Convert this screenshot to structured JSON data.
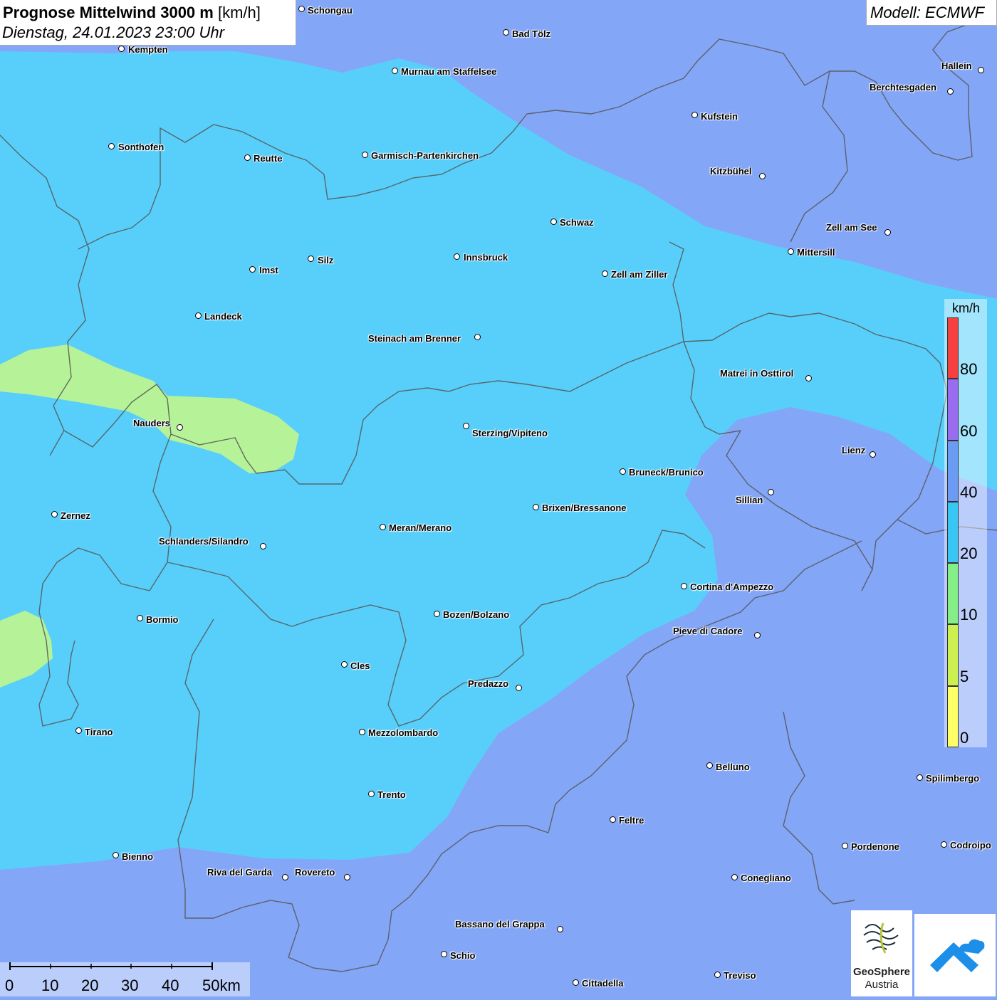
{
  "title": {
    "main_bold": "Prognose Mittelwind 3000 m",
    "main_unit": "[km/h]",
    "subtitle": "Dienstag, 24.01.2023 23:00 Uhr"
  },
  "model": "Modell: ECMWF",
  "legend": {
    "unit": "km/h",
    "classes": [
      {
        "label": "0",
        "color": "#ffff66"
      },
      {
        "label": "5",
        "color": "#ccf050"
      },
      {
        "label": "10",
        "color": "#84ef86"
      },
      {
        "label": "20",
        "color": "#38c6f4"
      },
      {
        "label": "40",
        "color": "#6b9bf2"
      },
      {
        "label": "60",
        "color": "#9a6cf0"
      },
      {
        "label": "80",
        "color": "#f64040"
      }
    ]
  },
  "field_colors": {
    "below_10": "#b6f297",
    "range_20_40": "#58cffa",
    "range_40_60": "#84a6f7"
  },
  "scale_bar": {
    "labels": [
      "0",
      "10",
      "20",
      "30",
      "40",
      "50km"
    ]
  },
  "cities": [
    "Schongau",
    "Bad Tölz",
    "Kempten",
    "Murnau am Staffelsee",
    "Hallein",
    "Berchtesgaden",
    "Kufstein",
    "Sonthofen",
    "Reutte",
    "Garmisch-Partenkirchen",
    "Kitzbühel",
    "Schwaz",
    "Zell am See",
    "Mittersill",
    "Innsbruck",
    "Silz",
    "Imst",
    "Zell am Ziller",
    "Landeck",
    "Steinach am Brenner",
    "Matrei in Osttirol",
    "Nauders",
    "Sterzing/Vipiteno",
    "Lienz",
    "Bruneck/Brunico",
    "Sillian",
    "Brixen/Bressanone",
    "Zernez",
    "Meran/Merano",
    "Schlanders/Silandro",
    "Cortina d'Ampezzo",
    "Bozen/Bolzano",
    "Bormio",
    "Pieve di Cadore",
    "Cles",
    "Predazzo",
    "Tirano",
    "Mezzolombardo",
    "Belluno",
    "Spilimbergo",
    "Trento",
    "Feltre",
    "Pordenone",
    "Codroipo",
    "Bienno",
    "Riva del Garda",
    "Rovereto",
    "Conegliano",
    "Bassano del Grappa",
    "Schio",
    "Treviso",
    "Cittadella"
  ],
  "logos": {
    "geosphere_line1": "GeoSphere",
    "geosphere_line2": "Austria"
  }
}
